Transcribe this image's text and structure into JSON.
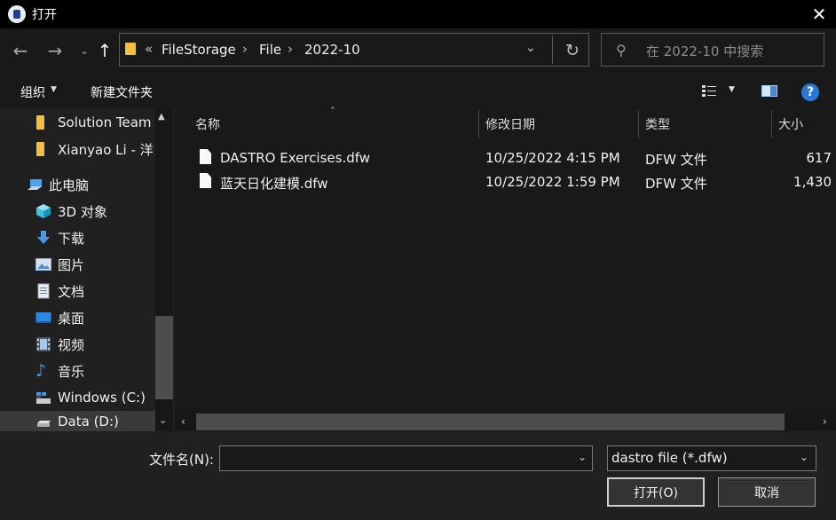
{
  "window": {
    "title": "打开"
  },
  "address": {
    "overflow": "«",
    "crumbs": [
      "FileStorage",
      "File",
      "2022-10"
    ]
  },
  "search": {
    "placeholder": "在 2022-10 中搜索"
  },
  "toolbar": {
    "organize": "组织",
    "new_folder": "新建文件夹",
    "help": "?"
  },
  "sidebar": {
    "items": [
      {
        "label": "Solution Team",
        "icon": "folder-icon"
      },
      {
        "label": "Xianyao Li - 洋洋",
        "icon": "folder-icon"
      },
      {
        "label": "此电脑",
        "icon": "computer-icon"
      },
      {
        "label": "3D 对象",
        "icon": "3d-objects-icon"
      },
      {
        "label": "下载",
        "icon": "download-icon"
      },
      {
        "label": "图片",
        "icon": "pictures-icon"
      },
      {
        "label": "文档",
        "icon": "documents-icon"
      },
      {
        "label": "桌面",
        "icon": "desktop-icon"
      },
      {
        "label": "视频",
        "icon": "videos-icon"
      },
      {
        "label": "音乐",
        "icon": "music-icon"
      },
      {
        "label": "Windows (C:)",
        "icon": "windows-drive-icon"
      },
      {
        "label": "Data (D:)",
        "icon": "drive-icon"
      }
    ]
  },
  "columns": {
    "name": "名称",
    "date": "修改日期",
    "type": "类型",
    "size": "大小"
  },
  "files": [
    {
      "name": "DASTRO Exercises.dfw",
      "date": "10/25/2022 4:15 PM",
      "type": "DFW 文件",
      "size": "617"
    },
    {
      "name": "蓝天日化建模.dfw",
      "date": "10/25/2022 1:59 PM",
      "type": "DFW 文件",
      "size": "1,430"
    }
  ],
  "bottom": {
    "filename_label": "文件名(N):",
    "filename_value": "",
    "filter": "dastro file (*.dfw)",
    "open": "打开(O)",
    "cancel": "取消"
  },
  "colors": {
    "background": "#202020",
    "panel": "#191919",
    "titlebar": "#000000",
    "accent": "#2a77d6",
    "folder": "#f1c043"
  }
}
